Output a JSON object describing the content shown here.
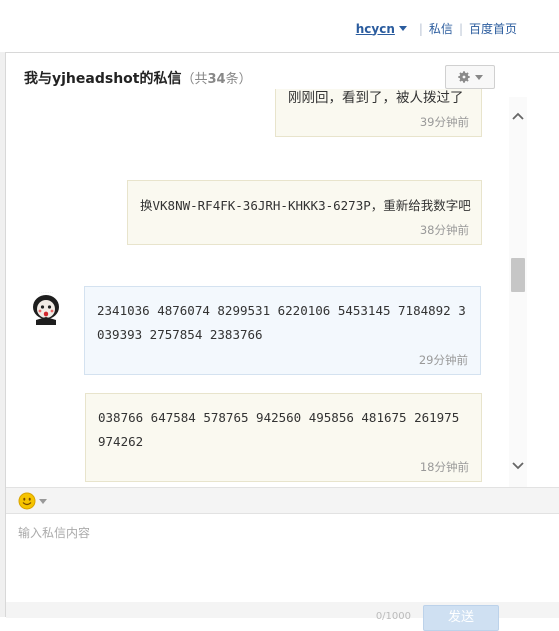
{
  "topnav": {
    "user": "hcycn",
    "sep1": "|",
    "messages": "私信",
    "sep2": "|",
    "home": "百度首页"
  },
  "dialog": {
    "title_prefix": "我与yjheadshot的私信",
    "count_open": "（共",
    "count_value": "34",
    "count_close": "条）"
  },
  "messages": [
    {
      "text": "刚刚回，看到了，被人拨过了",
      "time": "39分钟前",
      "direction": "outgoing"
    },
    {
      "text": "换VK8NW-RF4FK-36JRH-KHKK3-6273P，重新给我数字吧",
      "time": "38分钟前",
      "direction": "outgoing"
    },
    {
      "text": "2341036 4876074 8299531 6220106 5453145 7184892 3039393 2757854 2383766",
      "time": "29分钟前",
      "direction": "incoming"
    },
    {
      "text": "038766 647584 578765 942560 495856 481675 261975 974262",
      "time": "18分钟前",
      "direction": "incoming"
    }
  ],
  "composer": {
    "placeholder": "输入私信内容",
    "char_count": "0/1000",
    "send_label": "发送"
  },
  "icons": {
    "gear": "gear-icon",
    "emoji": "smiley-icon",
    "scroll_up": "chevron-up-icon",
    "scroll_down": "chevron-down-icon"
  },
  "colors": {
    "link": "#2b5c9e",
    "outgoing_bubble": "#faf9f0",
    "incoming_bubble": "#f3f8fd",
    "send_button": "#cfe0f2"
  }
}
